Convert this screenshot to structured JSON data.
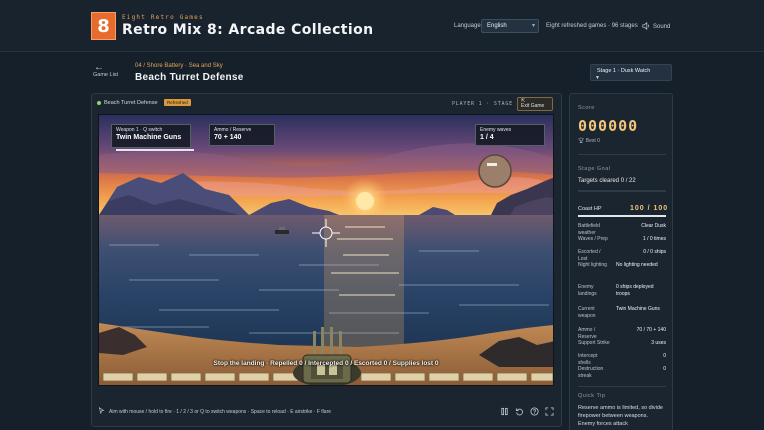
{
  "header": {
    "logo_text": "8",
    "subtitle": "Eight Retro Games",
    "title": "Retro Mix 8: Arcade Collection",
    "language_label": "Language",
    "language_value": "English",
    "refresh_info": "Eight refreshed games · 96 stages",
    "sound_label": "Sound"
  },
  "subheader": {
    "back_label": "Game List",
    "breadcrumb": "04 / Shore Battery · Sea and Sky",
    "title": "Beach Turret Defense",
    "stage_select_value": "Stage 1 · Dusk Watch"
  },
  "game": {
    "name": "Beach Turret Defense",
    "badge": "Refreshed",
    "player_stage": "PLAYER 1 · STAGE 01",
    "exit_label": "Exit Game",
    "hud": {
      "weapon_label": "Weapon 1 · Q switch",
      "weapon_value": "Twin Machine Guns",
      "ammo_label": "Ammo / Reserve",
      "ammo_value": "70 + 140",
      "enemy_label": "Enemy waves",
      "enemy_value": "1 / 4"
    },
    "status_text": "Stop the landing · Repelled 0 / Intercepted 0 / Escorted 0 / Supplies lost 0",
    "controls_hint": "Aim with mouse / hold to fire · 1 / 2 / 3 or Q to switch weapons · Space to reload · E airstrike · F flare"
  },
  "side": {
    "score_title": "Score",
    "score_value": "000000",
    "best_label": "Best 0",
    "goal_title": "Stage Goal",
    "goal_text": "Targets cleared 0 / 22",
    "goal_progress": 0,
    "coast_label": "Coast HP",
    "coast_value": "100 / 100",
    "coast_progress": 1,
    "stats": [
      {
        "k": "Battlefield weather",
        "v": "Clear Dusk"
      },
      {
        "k": "Waves / Prep",
        "v": "1 / 0 times"
      },
      {
        "k": "Escorted / Lost",
        "v": "0 / 0 ships"
      },
      {
        "k": "Night lighting",
        "v": "No lighting needed"
      },
      {
        "k": "Enemy landings",
        "v": "0 ships deployed troops"
      },
      {
        "k": "Current weapon",
        "v": "Twin Machine Guns"
      },
      {
        "k": "Ammo / Reserve",
        "v": "70 / 70 + 140"
      },
      {
        "k": "Support Strike",
        "v": "3 uses"
      },
      {
        "k": "Intercept shells",
        "v": "0"
      },
      {
        "k": "Destruction streak",
        "v": "0"
      }
    ],
    "tip_title": "Quick Tip",
    "tip_text": "Reserve ammo is limited, so divide firepower between weapons. Enemy forces attack"
  }
}
